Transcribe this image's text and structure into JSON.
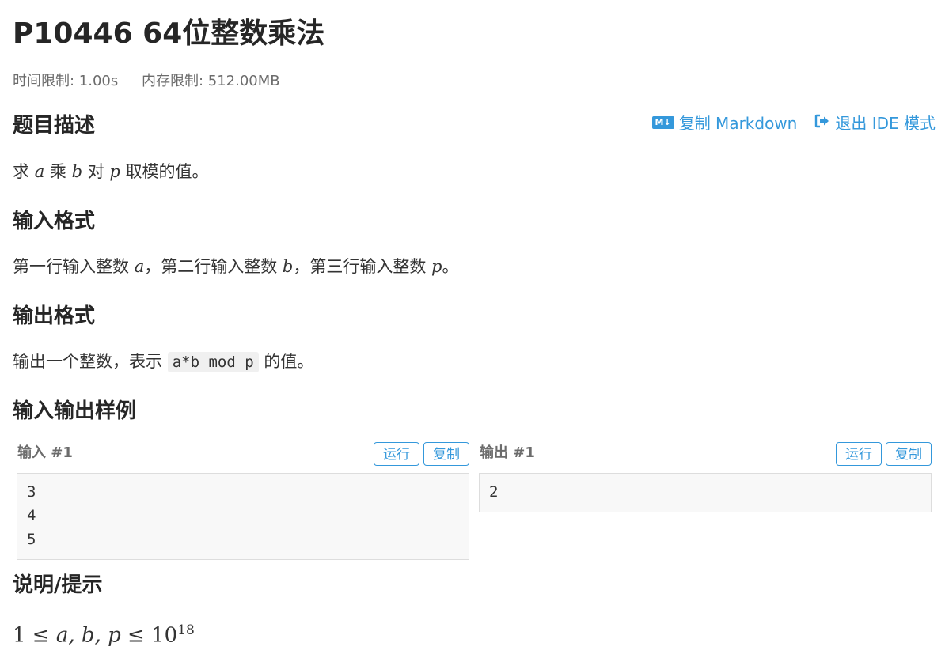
{
  "problem": {
    "title": "P10446 64位整数乘法",
    "time_limit": "时间限制: 1.00s",
    "memory_limit": "内存限制: 512.00MB"
  },
  "toolbar": {
    "copy_markdown": "复制 Markdown",
    "exit_ide": "退出 IDE 模式",
    "md_icon_text": "M↓",
    "exit_icon": "sign-out-icon",
    "accent_color": "#3498db"
  },
  "description": {
    "heading": "题目描述",
    "t1": "求 ",
    "a": "a",
    "t2": " 乘 ",
    "b": "b",
    "t3": " 对 ",
    "p": "p",
    "t4": " 取模的值。"
  },
  "input_format": {
    "heading": "输入格式",
    "t1": "第一行输入整数 ",
    "a": "a",
    "t2": "，第二行输入整数 ",
    "b": "b",
    "t3": "，第三行输入整数 ",
    "p": "p",
    "t4": "。"
  },
  "output_format": {
    "heading": "输出格式",
    "t1": "输出一个整数，表示 ",
    "code": "a*b mod p",
    "t2": " 的值。"
  },
  "samples": {
    "heading": "输入输出样例",
    "input_label": "输入 #1",
    "output_label": "输出 #1",
    "run": "运行",
    "copy": "复制",
    "input_lines": [
      "3",
      "4",
      "5"
    ],
    "output_lines": [
      "2"
    ]
  },
  "hint": {
    "heading": "说明/提示",
    "one": "1",
    "le1": " ≤ ",
    "vars": "a, b, p",
    "le2": " ≤ ",
    "ten": "10",
    "exp": "18"
  }
}
